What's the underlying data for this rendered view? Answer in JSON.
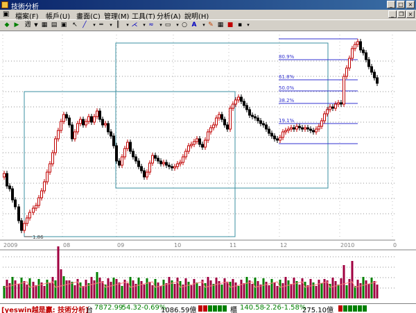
{
  "window": {
    "title": "技術分析"
  },
  "menu": [
    "檔案(F)",
    "帳戶(U)",
    "畫面(C)",
    "管理(M)",
    "工具(T)",
    "分析(A)",
    "說明(H)"
  ],
  "toolbar": {
    "period_label": "週"
  },
  "fib_levels": [
    "80.9%",
    "61.8%",
    "50.0%",
    "38.2%",
    "19.1%"
  ],
  "x_ticks": [
    "2009",
    "08",
    "09",
    "10",
    "11",
    "12",
    "2010",
    "0"
  ],
  "low_label": "1.86",
  "status": {
    "brand": "[yeswin越是贏: 技術分析]",
    "index1_name": "台",
    "index1_value": "7872.99",
    "index1_change": "-54.32",
    "index1_pct": "-0.69%",
    "index1_volume": "1086.59億",
    "index2_name": "櫃",
    "index2_value": "140.58",
    "index2_change": "-2.26",
    "index2_pct": "-1.58%",
    "index2_volume": "275.10億"
  },
  "colors": {
    "up": "#c00000",
    "down": "#000000",
    "box": "#3a8fa0",
    "fib": "#3030d0",
    "grid": "#909090",
    "volume": "#a00040",
    "volume_ma": "#ff8080"
  }
}
